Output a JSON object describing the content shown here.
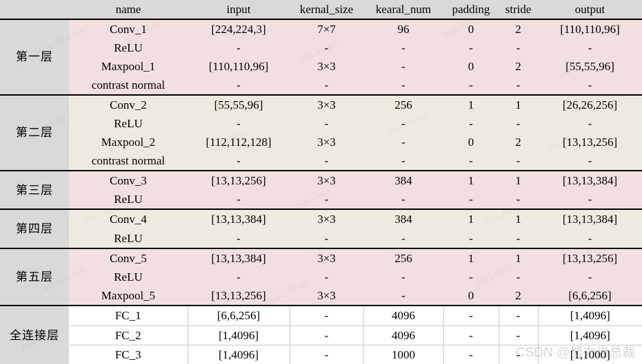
{
  "table": {
    "headers": {
      "layer": "",
      "name": "name",
      "input": "input",
      "kernal_size": "kernal_size",
      "kearal_num": "kearal_num",
      "padding": "padding",
      "stride": "stride",
      "output": "output"
    },
    "groups": [
      {
        "label": "第一层",
        "tint": "pink",
        "rows": [
          {
            "name": "Conv_1",
            "input": "[224,224,3]",
            "kernal_size": "7×7",
            "kearal_num": "96",
            "padding": "0",
            "stride": "2",
            "output": "[110,110,96]"
          },
          {
            "name": "ReLU",
            "input": "-",
            "kernal_size": "-",
            "kearal_num": "-",
            "padding": "-",
            "stride": "-",
            "output": "-"
          },
          {
            "name": "Maxpool_1",
            "input": "[110,110,96]",
            "kernal_size": "3×3",
            "kearal_num": "-",
            "padding": "0",
            "stride": "2",
            "output": "[55,55,96]"
          },
          {
            "name": "contrast normal",
            "input": "-",
            "kernal_size": "-",
            "kearal_num": "-",
            "padding": "-",
            "stride": "-",
            "output": "-"
          }
        ]
      },
      {
        "label": "第二层",
        "tint": "cream",
        "rows": [
          {
            "name": "Conv_2",
            "input": "[55,55,96]",
            "kernal_size": "3×3",
            "kearal_num": "256",
            "padding": "1",
            "stride": "1",
            "output": "[26,26,256]"
          },
          {
            "name": "ReLU",
            "input": "-",
            "kernal_size": "-",
            "kearal_num": "-",
            "padding": "-",
            "stride": "-",
            "output": "-"
          },
          {
            "name": "Maxpool_2",
            "input": "[112,112,128]",
            "kernal_size": "3×3",
            "kearal_num": "-",
            "padding": "0",
            "stride": "2",
            "output": "[13,13,256]"
          },
          {
            "name": "contrast normal",
            "input": "-",
            "kernal_size": "-",
            "kearal_num": "-",
            "padding": "-",
            "stride": "-",
            "output": "-"
          }
        ]
      },
      {
        "label": "第三层",
        "tint": "pink",
        "rows": [
          {
            "name": "Conv_3",
            "input": "[13,13,256]",
            "kernal_size": "3×3",
            "kearal_num": "384",
            "padding": "1",
            "stride": "1",
            "output": "[13,13,384]"
          },
          {
            "name": "ReLU",
            "input": "-",
            "kernal_size": "-",
            "kearal_num": "-",
            "padding": "-",
            "stride": "-",
            "output": "-"
          }
        ]
      },
      {
        "label": "第四层",
        "tint": "cream",
        "rows": [
          {
            "name": "Conv_4",
            "input": "[13,13,384]",
            "kernal_size": "3×3",
            "kearal_num": "384",
            "padding": "1",
            "stride": "1",
            "output": "[13,13,384]"
          },
          {
            "name": "ReLU",
            "input": "-",
            "kernal_size": "-",
            "kearal_num": "-",
            "padding": "-",
            "stride": "-",
            "output": "-"
          }
        ]
      },
      {
        "label": "第五层",
        "tint": "pink",
        "rows": [
          {
            "name": "Conv_5",
            "input": "[13,13,384]",
            "kernal_size": "3×3",
            "kearal_num": "256",
            "padding": "1",
            "stride": "1",
            "output": "[13,13,256]"
          },
          {
            "name": "ReLU",
            "input": "-",
            "kernal_size": "-",
            "kearal_num": "-",
            "padding": "-",
            "stride": "-",
            "output": "-"
          },
          {
            "name": "Maxpool_5",
            "input": "[13,13,256]",
            "kernal_size": "3×3",
            "kearal_num": "-",
            "padding": "0",
            "stride": "2",
            "output": "[6,6,256]"
          }
        ]
      },
      {
        "label": "全连接层",
        "tint": "white",
        "rows": [
          {
            "name": "FC_1",
            "input": "[6,6,256]",
            "kernal_size": "-",
            "kearal_num": "4096",
            "padding": "-",
            "stride": "-",
            "output": "[1,4096]"
          },
          {
            "name": "FC_2",
            "input": "[1,4096]",
            "kernal_size": "-",
            "kearal_num": "4096",
            "padding": "-",
            "stride": "-",
            "output": "[1,4096]"
          },
          {
            "name": "FC_3",
            "input": "[1,4096]",
            "kernal_size": "-",
            "kearal_num": "1000",
            "padding": "-",
            "stride": "-",
            "output": "[1,1000]"
          }
        ]
      }
    ]
  },
  "watermark": {
    "text": "CSDN @努力当总裁"
  },
  "colors": {
    "header_text": "#FF0000",
    "header_bg": "#D9D9D9",
    "layer_label_text": "#7B539E",
    "tint_pink": "#F2DFDF",
    "tint_cream": "#EDEBDF",
    "tint_white": "#FFFFFF",
    "body_text": "#000000"
  }
}
